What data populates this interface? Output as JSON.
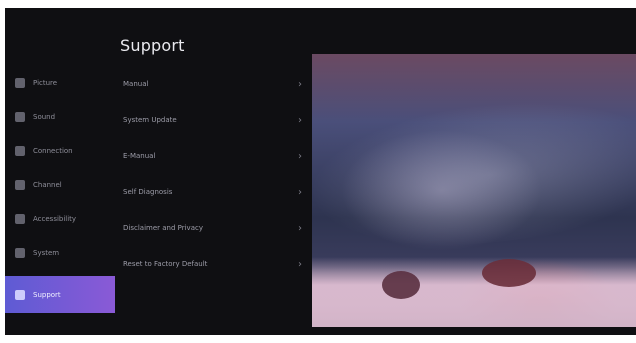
{
  "title": "Support",
  "sidebar": {
    "items": [
      {
        "label": "Picture",
        "icon": "picture-icon"
      },
      {
        "label": "Sound",
        "icon": "sound-icon"
      },
      {
        "label": "Connection",
        "icon": "connection-icon"
      },
      {
        "label": "Channel",
        "icon": "channel-icon"
      },
      {
        "label": "Accessibility",
        "icon": "accessibility-icon"
      },
      {
        "label": "System",
        "icon": "system-icon"
      },
      {
        "label": "Support",
        "icon": "support-icon",
        "active": true
      }
    ]
  },
  "menu": {
    "items": [
      {
        "label": "Manual"
      },
      {
        "label": "System Update"
      },
      {
        "label": "E-Manual"
      },
      {
        "label": "Self Diagnosis"
      },
      {
        "label": "Disclaimer and Privacy"
      },
      {
        "label": "Reset to Factory Default"
      }
    ]
  }
}
